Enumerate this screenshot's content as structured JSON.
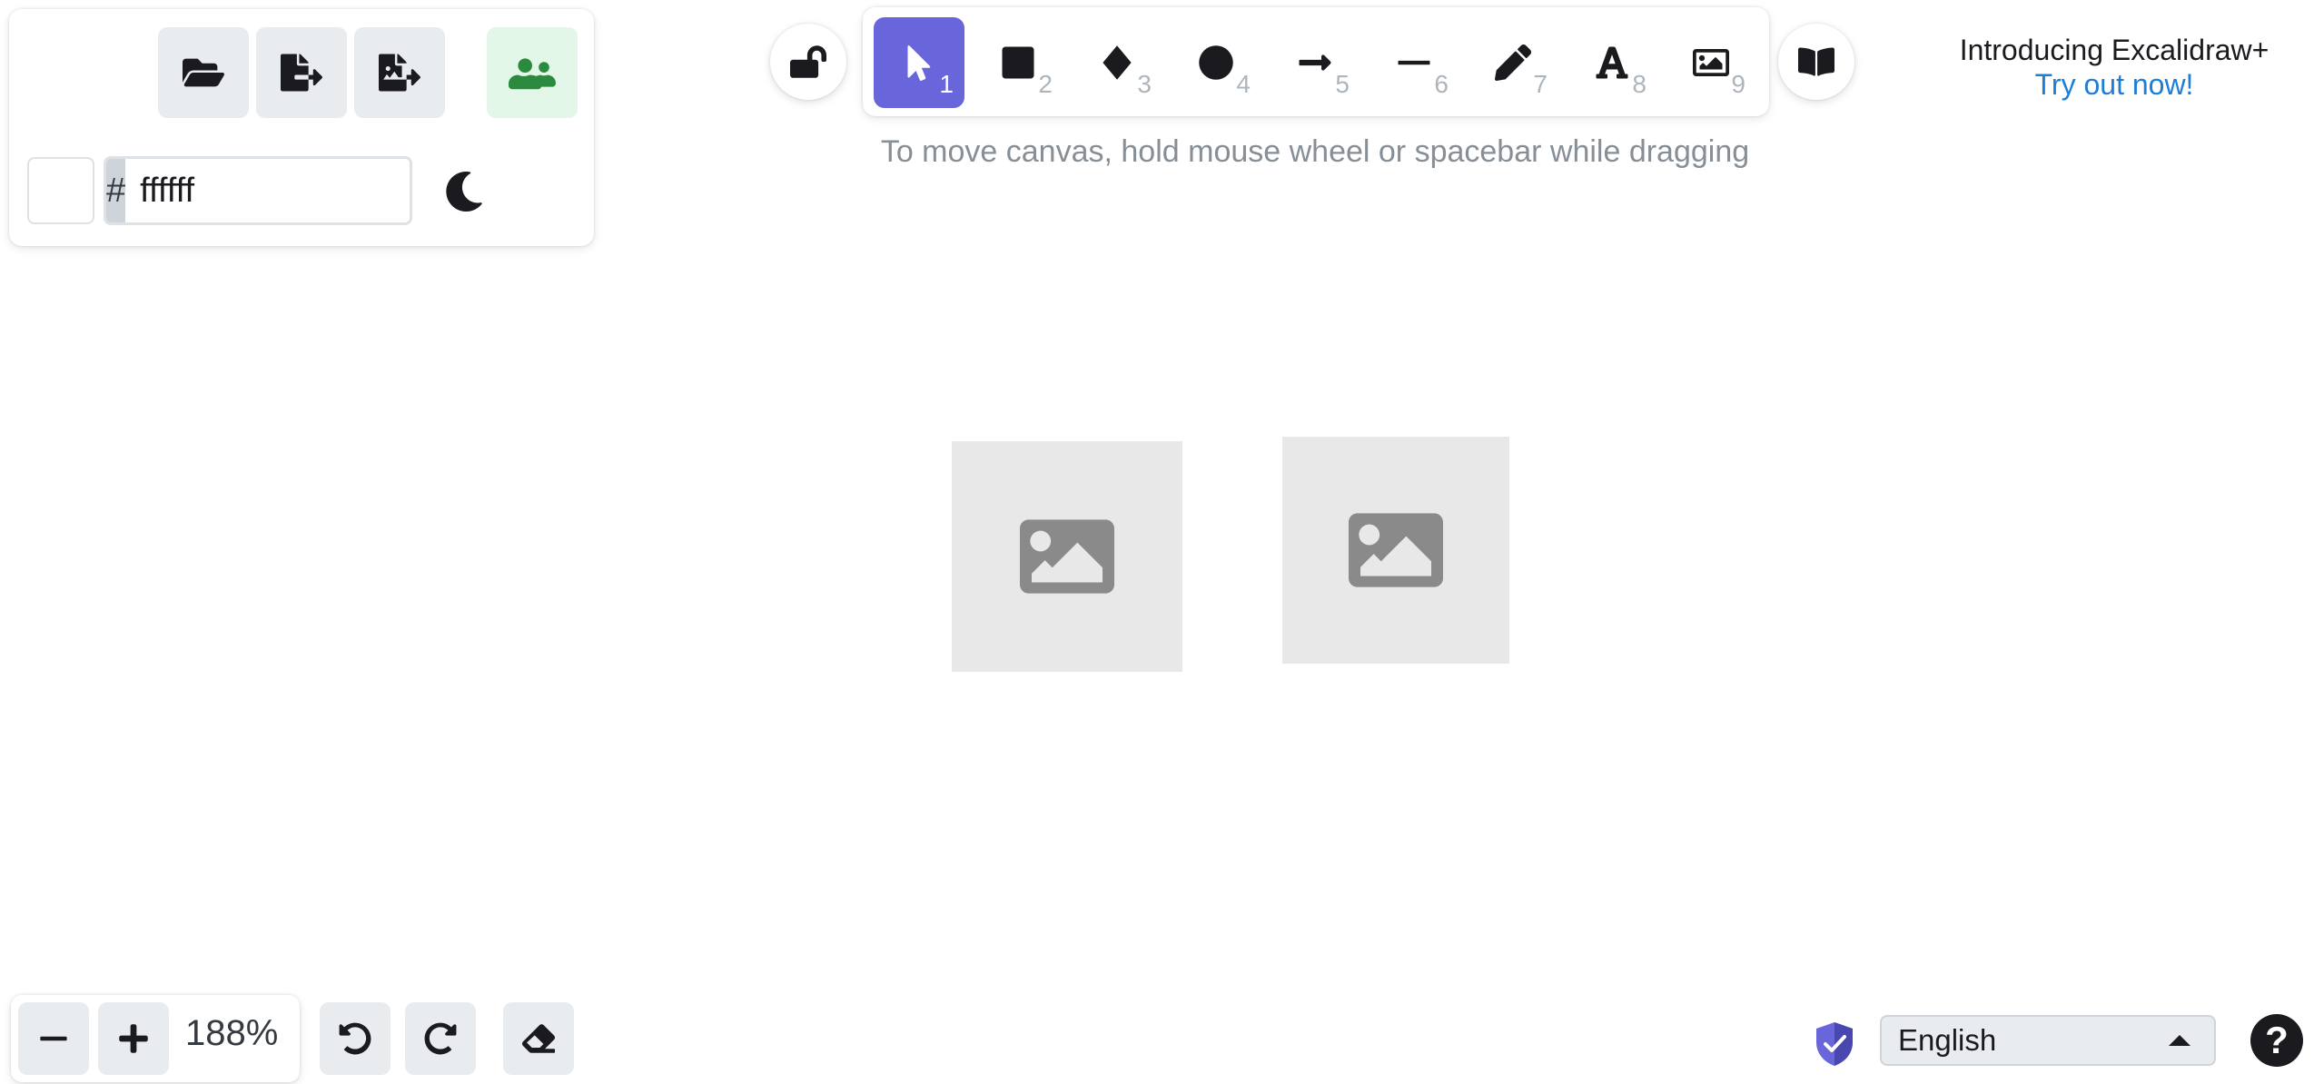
{
  "menu": {
    "buttons": [
      {
        "name": "open",
        "icon": "folder-open-icon"
      },
      {
        "name": "save-to",
        "icon": "file-export-icon"
      },
      {
        "name": "export-image",
        "icon": "image-export-icon"
      },
      {
        "name": "live-collaboration",
        "icon": "users-icon"
      }
    ]
  },
  "background": {
    "hash": "#",
    "value": "ffffff",
    "swatch_color": "#ffffff"
  },
  "toolbar": {
    "tools": [
      {
        "name": "selection",
        "key": "1",
        "active": true
      },
      {
        "name": "rectangle",
        "key": "2"
      },
      {
        "name": "diamond",
        "key": "3"
      },
      {
        "name": "ellipse",
        "key": "4"
      },
      {
        "name": "arrow",
        "key": "5"
      },
      {
        "name": "line",
        "key": "6"
      },
      {
        "name": "draw",
        "key": "7"
      },
      {
        "name": "text",
        "key": "8"
      },
      {
        "name": "image",
        "key": "9"
      }
    ],
    "accent": "#6965db"
  },
  "hint": "To move canvas, hold mouse wheel or spacebar while dragging",
  "promo": {
    "title": "Introducing Excalidraw+",
    "link": "Try out now!"
  },
  "footer": {
    "zoom_out": "−",
    "zoom_in": "+",
    "zoom_level": "188%",
    "language": "English",
    "help": "?"
  }
}
